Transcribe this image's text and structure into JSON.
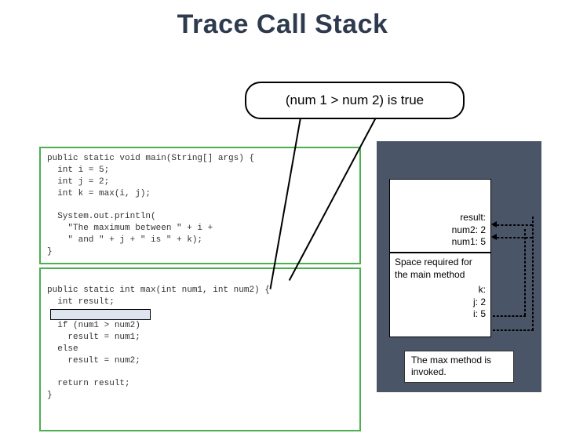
{
  "title": "Trace Call Stack",
  "callout": "(num 1 > num 2) is true",
  "code1": "public static void main(String[] args) {\n  int i = 5;\n  int j = 2;\n  int k = max(i, j);\n\n  System.out.println(\n    \"The maximum between \" + i +\n    \" and \" + j + \" is \" + k);\n}",
  "code2_l1": "public static int max(int num1, int num2) {",
  "code2_l2": "  int result;",
  "code2_l3": "",
  "code2_l4": "  if (num1 > num2)",
  "code2_l5": "    result = num1;",
  "code2_l6": "  else",
  "code2_l7": "    result = num2;",
  "code2_l8": "",
  "code2_l9": "  return result;",
  "code2_l10": "}",
  "stack_upper": {
    "l1": "result:",
    "l2": "num2: 2",
    "l3": "num1: 5"
  },
  "stack_lower": {
    "title": "Space required for the main method",
    "v1": "k:",
    "v2": "j: 2",
    "v3": "i: 5"
  },
  "note": "The max method is invoked."
}
